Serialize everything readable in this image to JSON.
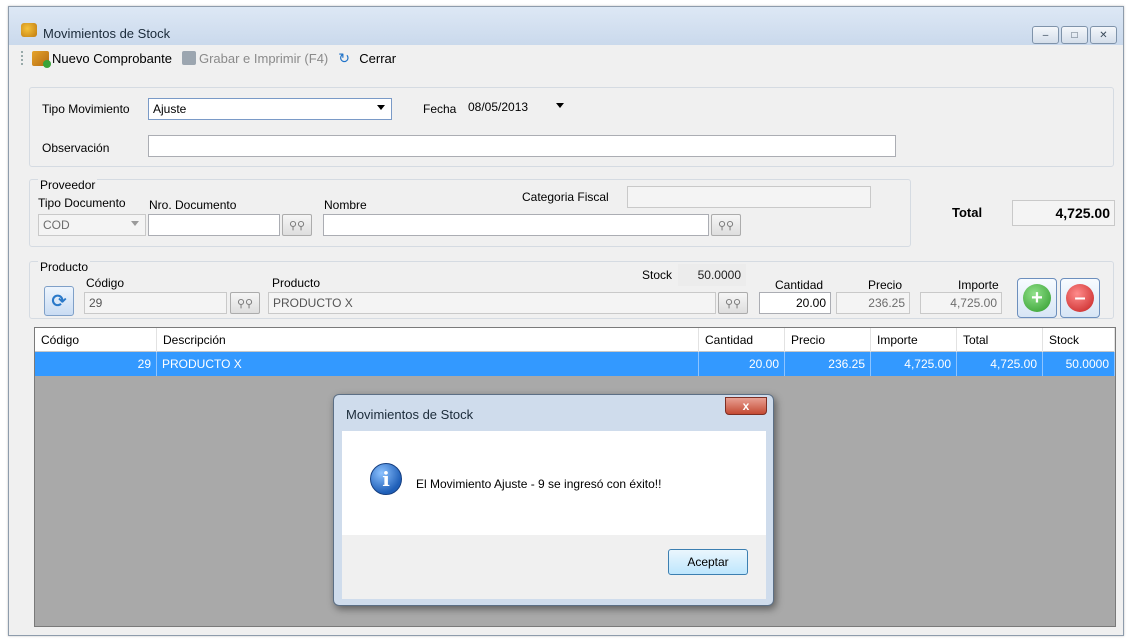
{
  "window": {
    "title": "Movimientos de Stock",
    "controls": {
      "minimize": "–",
      "maximize": "□",
      "close": "✕"
    }
  },
  "toolbar": {
    "new_label": "Nuevo Comprobante",
    "save_label": "Grabar e Imprimir (F4)",
    "close_label": "Cerrar"
  },
  "movimiento": {
    "tipo_label": "Tipo Movimiento",
    "tipo_value": "Ajuste",
    "fecha_label": "Fecha",
    "fecha_value": "08/05/2013",
    "observacion_label": "Observación",
    "observacion_value": ""
  },
  "proveedor": {
    "group_label": "Proveedor",
    "tipo_doc_label": "Tipo Documento",
    "tipo_doc_value": "COD",
    "nro_doc_label": "Nro. Documento",
    "nro_doc_value": "",
    "nombre_label": "Nombre",
    "nombre_value": "",
    "categoria_label": "Categoria Fiscal",
    "categoria_value": ""
  },
  "total": {
    "label": "Total",
    "value": "4,725.00"
  },
  "producto": {
    "group_label": "Producto",
    "codigo_label": "Código",
    "codigo_value": "29",
    "producto_label": "Producto",
    "producto_value": "PRODUCTO X",
    "stock_label": "Stock",
    "stock_value": "50.0000",
    "cantidad_label": "Cantidad",
    "cantidad_value": "20.00",
    "precio_label": "Precio",
    "precio_value": "236.25",
    "importe_label": "Importe",
    "importe_value": "4,725.00",
    "add_symbol": "+",
    "remove_symbol": "–"
  },
  "grid": {
    "headers": [
      "Código",
      "Descripción",
      "Cantidad",
      "Precio",
      "Importe",
      "Total",
      "Stock"
    ],
    "rows": [
      [
        "29",
        "PRODUCTO X",
        "20.00",
        "236.25",
        "4,725.00",
        "4,725.00",
        "50.0000"
      ]
    ]
  },
  "dialog": {
    "title": "Movimientos de Stock",
    "close_symbol": "x",
    "icon_symbol": "i",
    "message": "El Movimiento Ajuste - 9 se ingresó con éxito!!",
    "ok_label": "Aceptar"
  },
  "colors": {
    "selection": "#3399ff",
    "grid_background": "#a9a9a9",
    "add_button": "#3aaa35",
    "remove_button": "#d82b2b"
  }
}
